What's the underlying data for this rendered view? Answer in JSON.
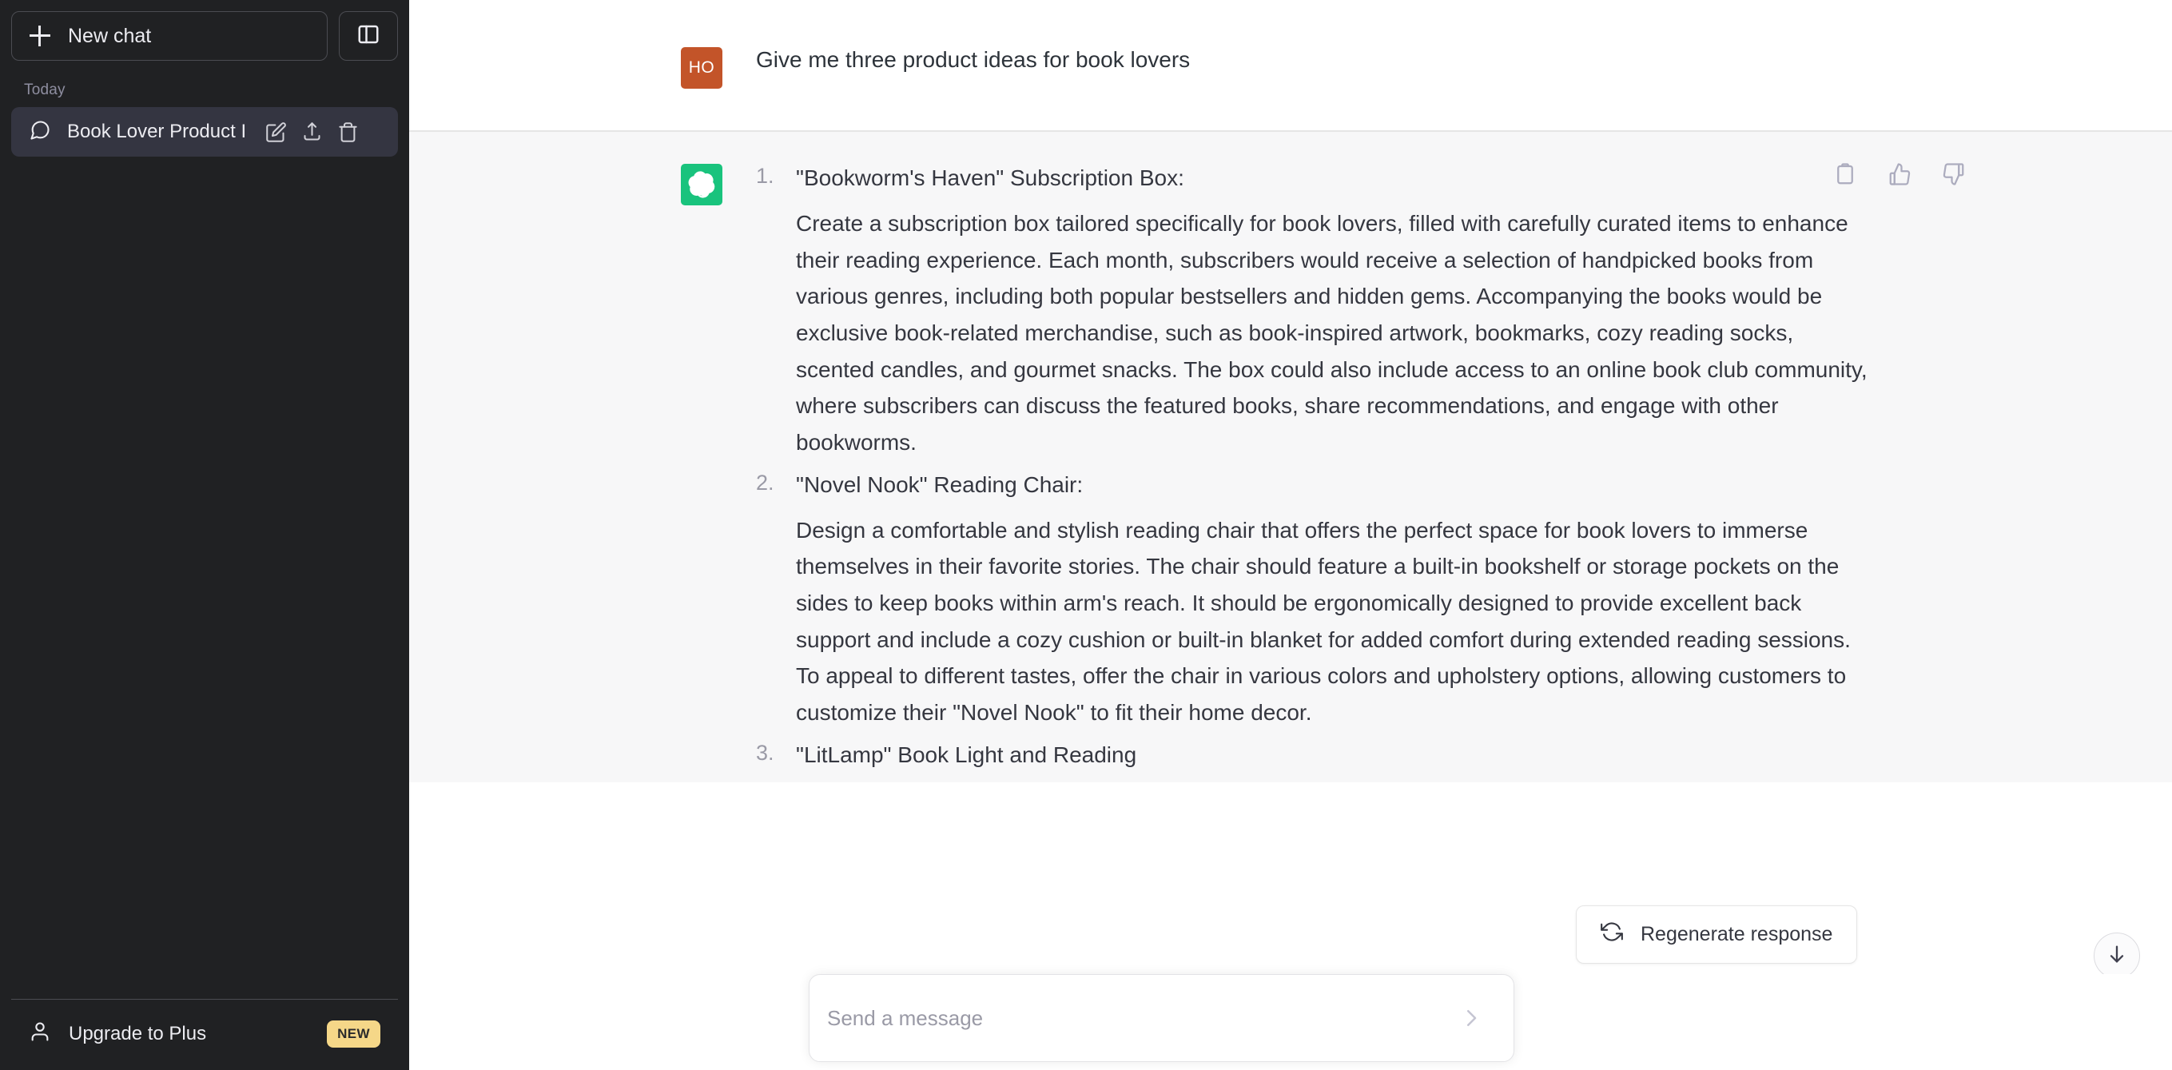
{
  "sidebar": {
    "new_chat_label": "New chat",
    "panel_toggle_name": "sidebar-toggle",
    "section_label": "Today",
    "chat_items": [
      {
        "title": "Book Lover Product I",
        "actions": [
          "edit",
          "share",
          "delete"
        ]
      }
    ],
    "upgrade_label": "Upgrade to Plus",
    "upgrade_badge": "NEW"
  },
  "conversation": {
    "user": {
      "avatar_initials": "HO",
      "avatar_color": "#c35429",
      "text": "Give me three product ideas for book lovers"
    },
    "assistant": {
      "avatar_color": "#19c37d",
      "actions": [
        "copy",
        "thumbs-up",
        "thumbs-down"
      ],
      "items": [
        {
          "number": "1.",
          "title": "\"Bookworm's Haven\" Subscription Box:",
          "description": "Create a subscription box tailored specifically for book lovers, filled with carefully curated items to enhance their reading experience. Each month, subscribers would receive a selection of handpicked books from various genres, including both popular bestsellers and hidden gems. Accompanying the books would be exclusive book-related merchandise, such as book-inspired artwork, bookmarks, cozy reading socks, scented candles, and gourmet snacks. The box could also include access to an online book club community, where subscribers can discuss the featured books, share recommendations, and engage with other bookworms."
        },
        {
          "number": "2.",
          "title": "\"Novel Nook\" Reading Chair:",
          "description": "Design a comfortable and stylish reading chair that offers the perfect space for book lovers to immerse themselves in their favorite stories. The chair should feature a built-in bookshelf or storage pockets on the sides to keep books within arm's reach. It should be ergonomically designed to provide excellent back support and include a cozy cushion or built-in blanket for added comfort during extended reading sessions. To appeal to different tastes, offer the chair in various colors and upholstery options, allowing customers to customize their \"Novel Nook\" to fit their home decor."
        },
        {
          "number": "3.",
          "title": "\"LitLamp\" Book Light and Reading",
          "description": ""
        }
      ]
    }
  },
  "regenerate": {
    "label": "Regenerate response",
    "icon": "refresh-icon"
  },
  "scroll_to_bottom": {
    "icon": "arrow-down-icon"
  },
  "composer": {
    "placeholder": "Send a message",
    "value": "",
    "send_icon": "send-icon"
  },
  "colors": {
    "sidebar_bg": "#202123",
    "chat_item_active": "#343541",
    "assistant_row_bg": "#f7f7f8",
    "brand_green": "#19c37d",
    "user_avatar": "#c35429",
    "badge_yellow": "#f5d788"
  }
}
